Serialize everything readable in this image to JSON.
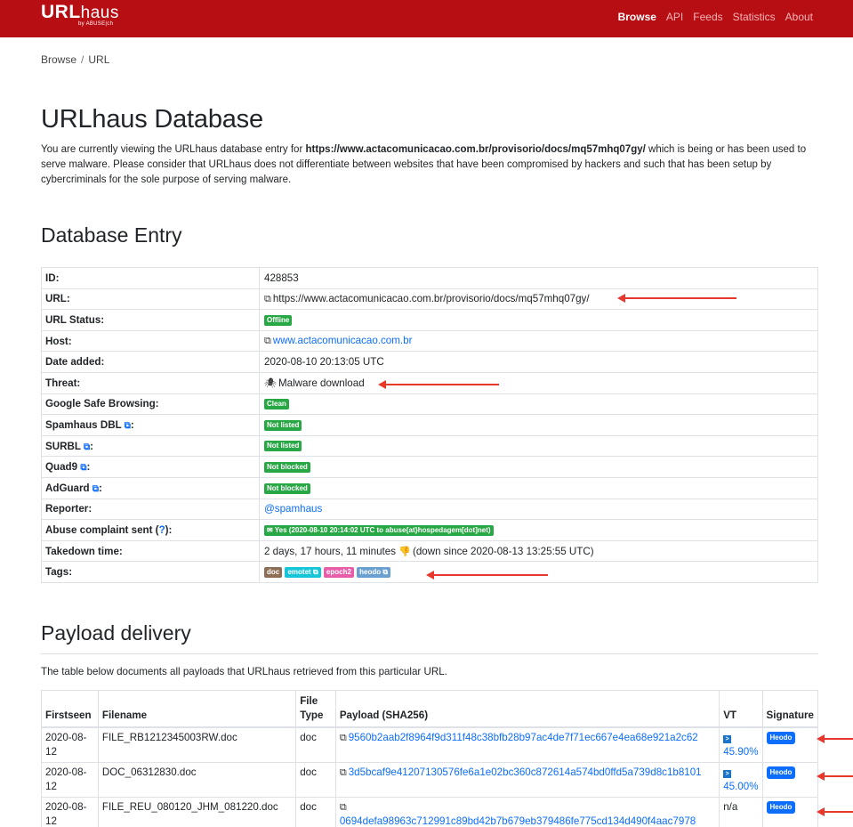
{
  "brand": {
    "main": "URL",
    "main_light": "haus",
    "sub": "by ABUSE|ch"
  },
  "nav": [
    "Browse",
    "API",
    "Feeds",
    "Statistics",
    "About"
  ],
  "breadcrumb": {
    "root": "Browse",
    "sep": "/",
    "current": "URL"
  },
  "page_title": "URLhaus Database",
  "intro": {
    "prefix": "You are currently viewing the URLhaus database entry for ",
    "url": "https://www.actacomunicacao.com.br/provisorio/docs/mq57mhq07gy/",
    "suffix": " which is being or has been used to serve malware. Please consider that URLhaus does not differentiate between websites that have been compromised by hackers and such that has been setup by cybercriminals for the sole purpose of serving malware."
  },
  "entry_heading": "Database Entry",
  "entry": {
    "id_label": "ID:",
    "id": "428853",
    "url_label": "URL:",
    "url": "https://www.actacomunicacao.com.br/provisorio/docs/mq57mhq07gy/",
    "status_label": "URL Status:",
    "status": "Offline",
    "host_label": "Host:",
    "host": "www.actacomunicacao.com.br",
    "date_label": "Date added:",
    "date": "2020-08-10 20:13:05 UTC",
    "threat_label": "Threat:",
    "threat": "Malware download",
    "gsb_label": "Google Safe Browsing:",
    "gsb": "Clean",
    "spamhaus_label": "Spamhaus DBL",
    "spamhaus": "Not listed",
    "surbl_label": "SURBL",
    "surbl": "Not listed",
    "quad9_label": "Quad9",
    "quad9": "Not blocked",
    "adguard_label": "AdGuard",
    "adguard": "Not blocked",
    "reporter_label": "Reporter:",
    "reporter": "@spamhaus",
    "abuse_label": "Abuse complaint sent (",
    "abuse_q": "?",
    "abuse_label_end": "):",
    "abuse": "Yes (2020-08-10 20:14:02 UTC to abuse{at}hospedagem[dot]net)",
    "takedown_label": "Takedown time:",
    "takedown": "2 days, 17 hours, 11 minutes",
    "takedown_since": "(down since 2020-08-13 13:25:55 UTC)",
    "tags_label": "Tags:",
    "tags": [
      "doc",
      "emotet",
      "epoch2",
      "heodo"
    ],
    "colon": ":"
  },
  "payload_heading": "Payload delivery",
  "payload_desc": "The table below documents all payloads that URLhaus retrieved from this particular URL.",
  "payload_headers": {
    "firstseen": "Firstseen",
    "filename": "Filename",
    "filetype_1": "File",
    "filetype_2": "Type",
    "payload": "Payload (SHA256)",
    "vt": "VT",
    "signature": "Signature"
  },
  "payload_rows": [
    {
      "date1": "2020-08-",
      "date2": "12",
      "filename": "FILE_RB1212345003RW.doc",
      "type": "doc",
      "sha1": "9560b2aab2f8964f9d311f48c38bfb28b97ac4de7f71ec667e4ea68e921a2c62",
      "sha2": "",
      "vt1": "",
      "vt2": "45.90%",
      "sig": "Heodo"
    },
    {
      "date1": "2020-08-",
      "date2": "12",
      "filename": "DOC_06312830.doc",
      "type": "doc",
      "sha1": "3d5bcaf9e41207130576fe6a1e02bc360c872614a574bd0ffd5a739d8c1b8101",
      "sha2": "",
      "vt1": "",
      "vt2": "45.00%",
      "sig": "Heodo"
    },
    {
      "date1": "2020-08-",
      "date2": "12",
      "filename": "FILE_REU_080120_JHM_081220.doc",
      "type": "doc",
      "sha1": "",
      "sha2": "0694defa98963c712991c89bd42b7b679eb379486fe775cd134d490f4aac7978",
      "vt1": "n/a",
      "vt2": "",
      "sig": "Heodo"
    }
  ],
  "colors": {
    "navbar": "#b70e14",
    "arrow": "#e8382b",
    "link": "#0d6efd",
    "badge_green": "#28a745"
  },
  "icons": [
    "copy-icon",
    "bug-icon",
    "external-link-icon",
    "thumbs-down-icon",
    "mail-icon",
    "virustotal-icon",
    "arrow-annotation"
  ]
}
